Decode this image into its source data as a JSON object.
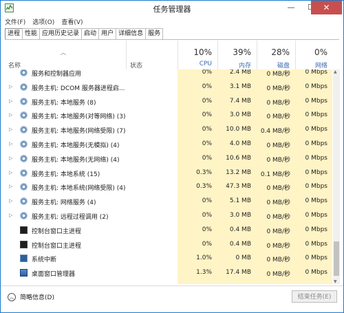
{
  "window": {
    "title": "任务管理器",
    "min": "—",
    "max": "☐",
    "close": "✕"
  },
  "menu": [
    "文件(F)",
    "选项(O)",
    "查看(V)"
  ],
  "tabs": [
    "进程",
    "性能",
    "应用历史记录",
    "启动",
    "用户",
    "详细信息",
    "服务"
  ],
  "header": {
    "name": "名称",
    "status": "状态",
    "cpu": {
      "pct": "10%",
      "label": "CPU"
    },
    "mem": {
      "pct": "39%",
      "label": "内存"
    },
    "disk": {
      "pct": "28%",
      "label": "磁盘"
    },
    "net": {
      "pct": "0%",
      "label": "网络"
    }
  },
  "rows": [
    {
      "expand": "",
      "icon": "gear",
      "name": "服务和控制器应用",
      "cpu": "0%",
      "mem": "2.4 MB",
      "disk": "0 MB/秒",
      "net": "0 Mbps"
    },
    {
      "expand": "▷",
      "icon": "gear",
      "name": "服务主机: DCOM 服务器进程启...",
      "cpu": "0%",
      "mem": "3.1 MB",
      "disk": "0 MB/秒",
      "net": "0 Mbps"
    },
    {
      "expand": "▷",
      "icon": "gear",
      "name": "服务主机: 本地服务 (8)",
      "cpu": "0%",
      "mem": "7.4 MB",
      "disk": "0 MB/秒",
      "net": "0 Mbps"
    },
    {
      "expand": "▷",
      "icon": "gear",
      "name": "服务主机: 本地服务(对等网络) (3)",
      "cpu": "0%",
      "mem": "3.0 MB",
      "disk": "0 MB/秒",
      "net": "0 Mbps"
    },
    {
      "expand": "▷",
      "icon": "gear",
      "name": "服务主机: 本地服务(网络受限) (7)",
      "cpu": "0%",
      "mem": "10.0 MB",
      "disk": "0.4 MB/秒",
      "net": "0 Mbps"
    },
    {
      "expand": "▷",
      "icon": "gear",
      "name": "服务主机: 本地服务(无模拟) (4)",
      "cpu": "0%",
      "mem": "4.0 MB",
      "disk": "0 MB/秒",
      "net": "0 Mbps"
    },
    {
      "expand": "▷",
      "icon": "gear",
      "name": "服务主机: 本地服务(无网络) (4)",
      "cpu": "0%",
      "mem": "10.6 MB",
      "disk": "0 MB/秒",
      "net": "0 Mbps"
    },
    {
      "expand": "▷",
      "icon": "gear",
      "name": "服务主机: 本地系统 (15)",
      "cpu": "0.3%",
      "mem": "13.2 MB",
      "disk": "0.1 MB/秒",
      "net": "0 Mbps"
    },
    {
      "expand": "▷",
      "icon": "gear",
      "name": "服务主机: 本地系统(网络受限) (4)",
      "cpu": "0.3%",
      "mem": "47.3 MB",
      "disk": "0 MB/秒",
      "net": "0 Mbps"
    },
    {
      "expand": "▷",
      "icon": "gear",
      "name": "服务主机: 网络服务 (4)",
      "cpu": "0%",
      "mem": "5.1 MB",
      "disk": "0 MB/秒",
      "net": "0 Mbps"
    },
    {
      "expand": "▷",
      "icon": "gear",
      "name": "服务主机: 远程过程调用 (2)",
      "cpu": "0%",
      "mem": "3.0 MB",
      "disk": "0 MB/秒",
      "net": "0 Mbps"
    },
    {
      "expand": "",
      "icon": "console",
      "name": "控制台窗口主进程",
      "cpu": "0%",
      "mem": "0.4 MB",
      "disk": "0 MB/秒",
      "net": "0 Mbps"
    },
    {
      "expand": "",
      "icon": "console",
      "name": "控制台窗口主进程",
      "cpu": "0%",
      "mem": "0.4 MB",
      "disk": "0 MB/秒",
      "net": "0 Mbps"
    },
    {
      "expand": "",
      "icon": "sys",
      "name": "系统中断",
      "cpu": "1.0%",
      "mem": "0 MB",
      "disk": "0 MB/秒",
      "net": "0 Mbps"
    },
    {
      "expand": "",
      "icon": "dwm",
      "name": "桌面窗口管理器",
      "cpu": "1.3%",
      "mem": "17.4 MB",
      "disk": "0 MB/秒",
      "net": "0 Mbps"
    }
  ],
  "footer": {
    "fewer": "简略信息(D)",
    "endtask": "结束任务(E)"
  }
}
